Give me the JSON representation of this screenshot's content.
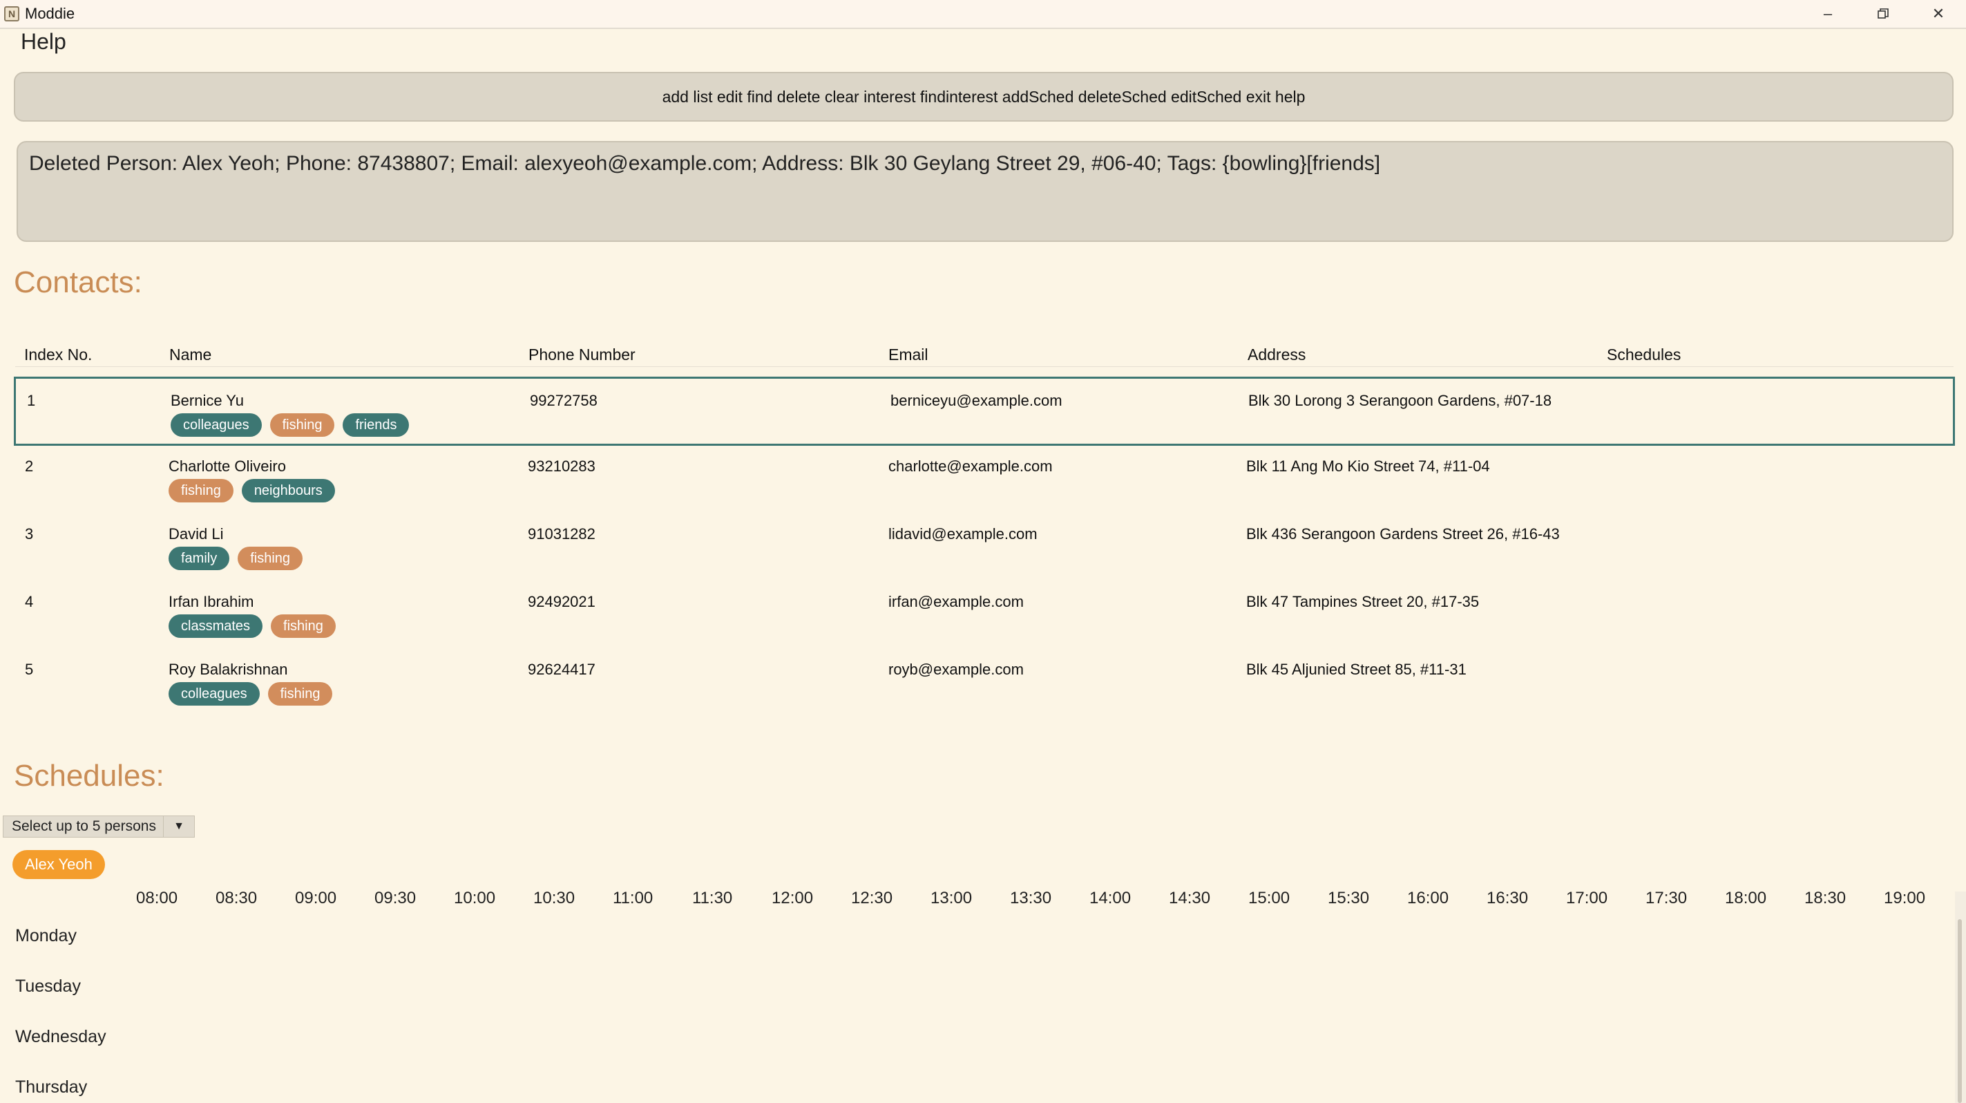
{
  "window": {
    "title": "Moddie",
    "icon": "app-logo-icon",
    "controls": [
      "minimize-icon",
      "restore-icon",
      "close-icon"
    ]
  },
  "menu": {
    "help": "Help"
  },
  "command_bar": {
    "text": "add list edit find delete clear interest findinterest addSched deleteSched editSched exit help"
  },
  "result": {
    "text": "Deleted Person: Alex Yeoh; Phone: 87438807; Email: alexyeoh@example.com; Address: Blk 30 Geylang Street 29, #06-40; Tags: {bowling}[friends]"
  },
  "contacts": {
    "title": "Contacts:",
    "headers": [
      "Index No.",
      "Name",
      "Phone Number",
      "Email",
      "Address",
      "Schedules"
    ],
    "selected_index": 0,
    "rows": [
      {
        "index": "1",
        "name": "Bernice Yu",
        "phone": "99272758",
        "email": "berniceyu@example.com",
        "address": "Blk 30 Lorong 3 Serangoon Gardens, #07-18",
        "tags": [
          {
            "label": "colleagues",
            "color": "#3d7773"
          },
          {
            "label": "fishing",
            "color": "#d28d5c"
          },
          {
            "label": "friends",
            "color": "#3d7773"
          }
        ]
      },
      {
        "index": "2",
        "name": "Charlotte Oliveiro",
        "phone": "93210283",
        "email": "charlotte@example.com",
        "address": "Blk 11 Ang Mo Kio Street 74, #11-04",
        "tags": [
          {
            "label": "fishing",
            "color": "#d28d5c"
          },
          {
            "label": "neighbours",
            "color": "#3d7773"
          }
        ]
      },
      {
        "index": "3",
        "name": "David Li",
        "phone": "91031282",
        "email": "lidavid@example.com",
        "address": "Blk 436 Serangoon Gardens Street 26, #16-43",
        "tags": [
          {
            "label": "family",
            "color": "#3d7773"
          },
          {
            "label": "fishing",
            "color": "#d28d5c"
          }
        ]
      },
      {
        "index": "4",
        "name": "Irfan Ibrahim",
        "phone": "92492021",
        "email": "irfan@example.com",
        "address": "Blk 47 Tampines Street 20, #17-35",
        "tags": [
          {
            "label": "classmates",
            "color": "#3d7773"
          },
          {
            "label": "fishing",
            "color": "#d28d5c"
          }
        ]
      },
      {
        "index": "5",
        "name": "Roy Balakrishnan",
        "phone": "92624417",
        "email": "royb@example.com",
        "address": "Blk 45 Aljunied Street 85, #11-31",
        "tags": [
          {
            "label": "colleagues",
            "color": "#3d7773"
          },
          {
            "label": "fishing",
            "color": "#d28d5c"
          }
        ]
      }
    ]
  },
  "schedules": {
    "title": "Schedules:",
    "select_label": "Select up to 5 persons",
    "selected_persons": [
      "Alex Yeoh"
    ],
    "times": [
      "08:00",
      "08:30",
      "09:00",
      "09:30",
      "10:00",
      "10:30",
      "11:00",
      "11:30",
      "12:00",
      "12:30",
      "13:00",
      "13:30",
      "14:00",
      "14:30",
      "15:00",
      "15:30",
      "16:00",
      "16:30",
      "17:00",
      "17:30",
      "18:00",
      "18:30",
      "19:00"
    ],
    "days": [
      "Monday",
      "Tuesday",
      "Wednesday",
      "Thursday"
    ]
  },
  "colors": {
    "accent_title": "#c98c55",
    "tag_teal": "#3d7773",
    "tag_orange": "#d28d5c",
    "chip": "#f49d2c",
    "background": "#fcf5e5"
  }
}
